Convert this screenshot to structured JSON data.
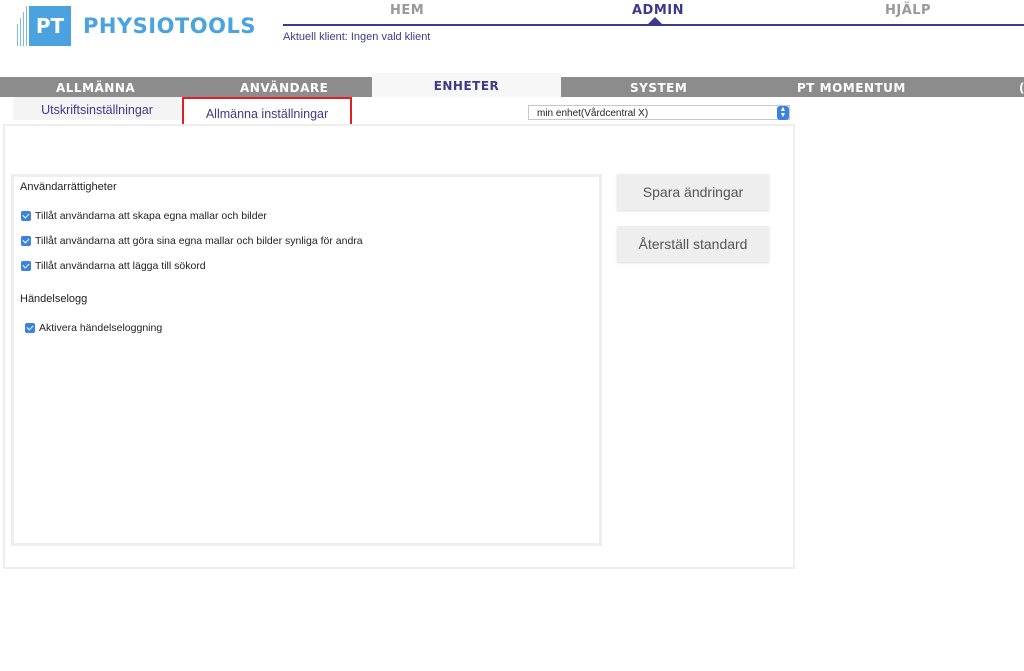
{
  "header": {
    "logo_mark": "PT",
    "logo_text": "PHYSIOTOOLS",
    "nav": [
      {
        "label": "HEM"
      },
      {
        "label": "ADMIN"
      },
      {
        "label": "HJÄLP"
      }
    ],
    "client_line": "Aktuell klient: Ingen vald klient"
  },
  "main_tabs": [
    {
      "label": "ALLMÄNNA"
    },
    {
      "label": "ANVÄNDARE"
    },
    {
      "label": "ENHETER"
    },
    {
      "label": "SYSTEM"
    },
    {
      "label": "PT MOMENTUM"
    },
    {
      "label": "("
    }
  ],
  "sub_tabs": {
    "print": "Utskriftsinställningar",
    "general": "Allmänna inställningar"
  },
  "unit_select": {
    "value": "min enhet(Vårdcentral X)"
  },
  "settings": {
    "rights_title": "Användarrättigheter",
    "rights": [
      {
        "label": "Tillåt användarna att skapa egna mallar och bilder",
        "checked": true
      },
      {
        "label": "Tillåt användarna att göra sina egna mallar och bilder synliga för andra",
        "checked": true
      },
      {
        "label": "Tillåt användarna att lägga till sökord",
        "checked": true
      }
    ],
    "log_title": "Händelselogg",
    "log": [
      {
        "label": "Aktivera händelseloggning",
        "checked": true
      }
    ]
  },
  "buttons": {
    "save": "Spara ändringar",
    "reset": "Återställ standard"
  },
  "colors": {
    "brand": "#4aa3df",
    "nav_active": "#3d3a8c",
    "highlight": "#e31e24",
    "checkbox": "#3b83e0"
  }
}
